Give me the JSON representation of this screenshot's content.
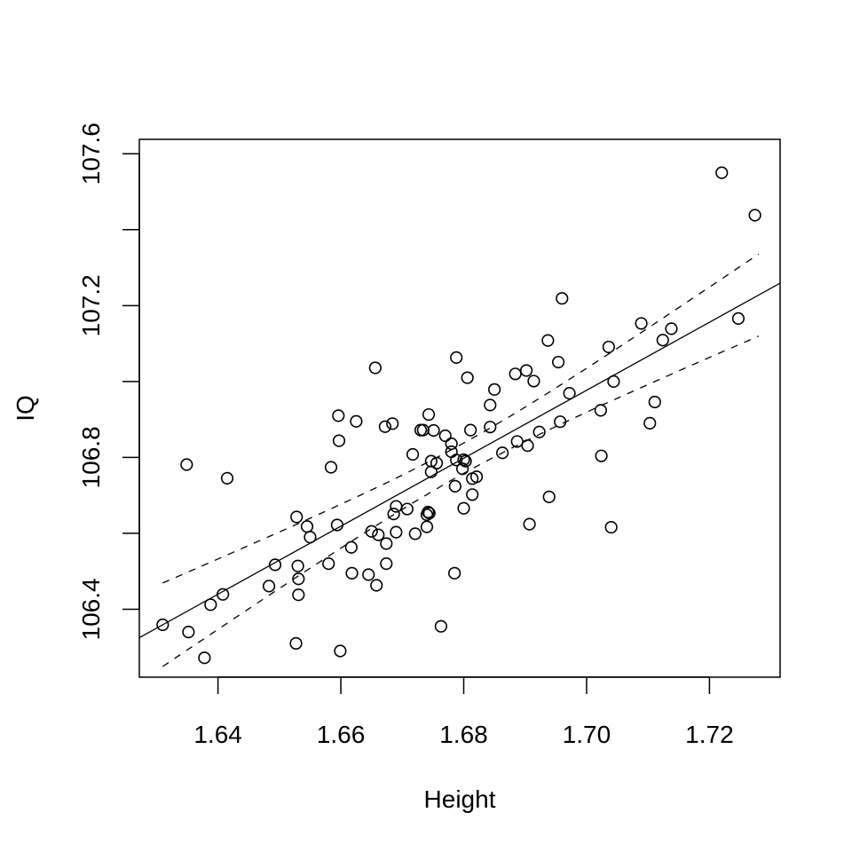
{
  "chart_data": {
    "type": "scatter",
    "title": "",
    "xlabel": "Height",
    "ylabel": "IQ",
    "xlim": [
      1.6272,
      1.7315
    ],
    "ylim": [
      106.221,
      107.638
    ],
    "xticks": [
      1.64,
      1.66,
      1.68,
      1.7,
      1.72
    ],
    "xtick_labels": [
      "1.64",
      "1.66",
      "1.68",
      "1.70",
      "1.72"
    ],
    "yticks": [
      106.4,
      106.6,
      106.8,
      107.0,
      107.2,
      107.4,
      107.6
    ],
    "ytick_labels": [
      "106.4",
      "",
      "106.8",
      "",
      "107.2",
      "",
      "107.6"
    ],
    "grid": false,
    "legend": "none",
    "points": {
      "x": [
        1.6349,
        1.6415,
        1.6528,
        1.6545,
        1.655,
        1.6493,
        1.653,
        1.6531,
        1.6483,
        1.6531,
        1.6408,
        1.6388,
        1.631,
        1.6352,
        1.6527,
        1.6378,
        1.6596,
        1.6625,
        1.6672,
        1.6684,
        1.6743,
        1.673,
        1.6734,
        1.6751,
        1.677,
        1.6811,
        1.6597,
        1.678,
        1.678,
        1.6717,
        1.6747,
        1.6756,
        1.6788,
        1.68,
        1.6803,
        1.6584,
        1.6747,
        1.6798,
        1.6814,
        1.6821,
        1.6786,
        1.6814,
        1.68,
        1.669,
        1.6708,
        1.6686,
        1.6742,
        1.6744,
        1.674,
        1.6594,
        1.665,
        1.6661,
        1.669,
        1.6721,
        1.674,
        1.6674,
        1.6617,
        1.658,
        1.6674,
        1.6618,
        1.6645,
        1.6658,
        1.6785,
        1.6763,
        1.6599,
        1.6656,
        1.6788,
        1.6806,
        1.685,
        1.6843,
        1.6884,
        1.6902,
        1.6914,
        1.6954,
        1.6843,
        1.6957,
        1.6923,
        1.6887,
        1.6904,
        1.6863,
        1.7024,
        1.6939,
        1.6907,
        1.704,
        1.7036,
        1.7044,
        1.6972,
        1.7023,
        1.696,
        1.6937,
        1.7089,
        1.7138,
        1.7124,
        1.7247,
        1.7111,
        1.7103,
        1.722,
        1.7274
      ],
      "y": [
        106.781,
        106.745,
        106.643,
        106.618,
        106.59,
        106.517,
        106.514,
        106.48,
        106.461,
        106.438,
        106.439,
        106.412,
        106.359,
        106.34,
        106.31,
        106.272,
        106.91,
        106.895,
        106.881,
        106.889,
        106.913,
        106.872,
        106.872,
        106.871,
        106.857,
        106.872,
        106.844,
        106.836,
        106.815,
        106.808,
        106.79,
        106.785,
        106.793,
        106.794,
        106.79,
        106.774,
        106.762,
        106.77,
        106.744,
        106.749,
        106.724,
        106.702,
        106.666,
        106.671,
        106.664,
        106.651,
        106.656,
        106.653,
        106.649,
        106.622,
        106.605,
        106.596,
        106.603,
        106.599,
        106.617,
        106.573,
        106.563,
        106.52,
        106.52,
        106.495,
        106.491,
        106.463,
        106.495,
        106.355,
        106.29,
        107.036,
        107.063,
        107.01,
        106.979,
        106.938,
        107.02,
        107.029,
        107.001,
        107.051,
        106.88,
        106.894,
        106.867,
        106.842,
        106.831,
        106.812,
        106.804,
        106.696,
        106.624,
        106.616,
        107.091,
        107,
        106.969,
        106.924,
        107.219,
        107.108,
        107.153,
        107.139,
        107.109,
        107.166,
        106.946,
        106.89,
        107.55,
        107.438
      ]
    },
    "regression_line": {
      "x": [
        1.6272,
        1.7315
      ],
      "y": [
        106.325,
        107.259
      ]
    },
    "confidence_band": {
      "x_range": [
        1.631,
        1.728
      ],
      "x_center": 1.68,
      "y_at_center": 106.682,
      "halfwidth_at_center": 0.04,
      "upper": {
        "x": [
          1.631,
          1.6804,
          1.728
        ],
        "y": [
          106.463,
          106.729,
          107.338
        ]
      },
      "lower": {
        "x": [
          1.631,
          1.6804,
          1.728
        ],
        "y": [
          106.257,
          106.643,
          107.104
        ]
      }
    }
  }
}
